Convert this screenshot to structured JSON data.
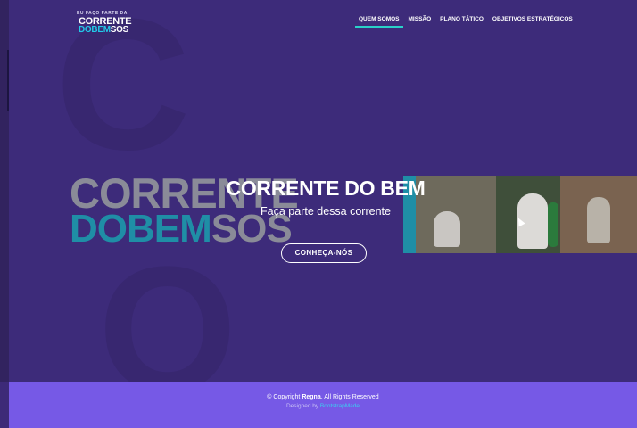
{
  "brand": {
    "logo_tagline": "EU FAÇO PARTE DA",
    "logo_line1": "CORRENTE",
    "logo_line2_a": "DO",
    "logo_line2_b": "BEM",
    "logo_line2_c": "SOS"
  },
  "nav": {
    "items": [
      {
        "label": "QUEM SOMOS",
        "active": true
      },
      {
        "label": "MISSÃO",
        "active": false
      },
      {
        "label": "PLANO TÁTICO",
        "active": false
      },
      {
        "label": "OBJETIVOS ESTRATÉGICOS",
        "active": false
      }
    ]
  },
  "hero": {
    "brand_line1": "CORRENTE",
    "brand_line2_a": "DO",
    "brand_line2_b": "BEM",
    "brand_line2_c": "SOS",
    "title": "CORRENTE DO BEM",
    "subtitle": "Faça parte dessa corrente",
    "cta_label": "CONHEÇA-NÓS"
  },
  "footer": {
    "copyright_prefix": "© Copyright",
    "copyright_brand": "Regna",
    "copyright_suffix": ". All Rights Reserved",
    "credit_prefix": "Designed by",
    "credit_link": "BootstrapMade"
  },
  "colors": {
    "background": "#3d2b7a",
    "footer": "#7659e6",
    "accent": "#2ad1c8",
    "brand_cyan": "#22c8e8"
  }
}
